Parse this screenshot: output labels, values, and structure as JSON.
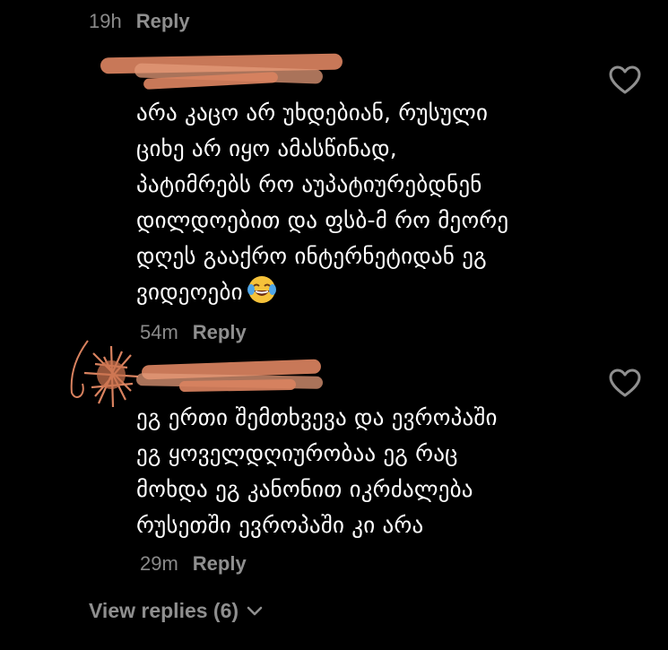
{
  "top_comment": {
    "timestamp": "19h",
    "reply_label": "Reply"
  },
  "comments": [
    {
      "lines": [
        "არა კაცო არ უხდებიან, რუსული",
        "ციხე არ იყო ამასწინად,",
        "პატიმრებს რო აუპატიურებდნენ",
        "დილდოებით და ფსბ-მ რო მეორე",
        "დღეს გააქრო ინტერნეტიდან ეგ",
        "ვიდეოები"
      ],
      "emoji": "face-with-tears-of-joy",
      "timestamp": "54m",
      "reply_label": "Reply",
      "like_icon": "heart-outline-icon"
    },
    {
      "lines": [
        "ეგ ერთი შემთხვევა და ევროპაში",
        "ეგ ყოველდღიურობაა ეგ რაც",
        "მოხდა ეგ კანონით იკრძალება",
        "რუსეთში ევროპაში კი არა"
      ],
      "timestamp": "29m",
      "reply_label": "Reply",
      "like_icon": "heart-outline-icon"
    }
  ],
  "view_replies": {
    "label": "View replies (6)"
  },
  "colors": {
    "background": "#000000",
    "text": "#ffffff",
    "muted": "#8a8a8a",
    "redaction": "#d9825f"
  }
}
